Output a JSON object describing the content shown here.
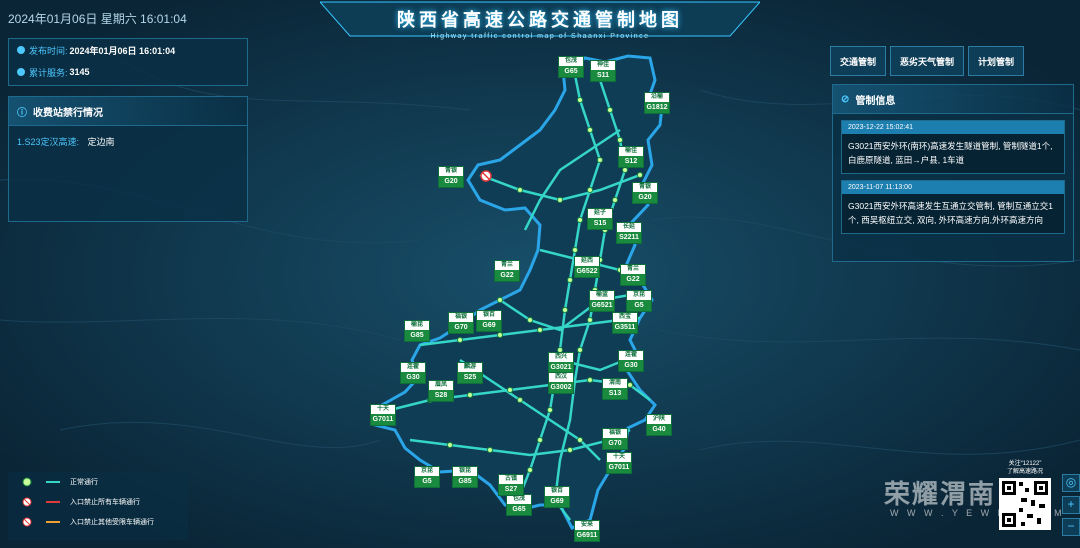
{
  "header": {
    "datetime": "2024年01月06日 星期六  16:01:04",
    "title": "陕西省高速公路交通管制地图",
    "subtitle": "Highway traffic control map of Shaanxi Province"
  },
  "info": {
    "publish_label": "发布时间:",
    "publish_value": "2024年01月06日 16:01:04",
    "service_label": "累计服务:",
    "service_value": "3145"
  },
  "toll": {
    "title": "收费站禁行情况",
    "items": [
      {
        "road": "1.S23定汉高速:",
        "place": "定边南"
      }
    ]
  },
  "tabs": [
    "交通管制",
    "恶劣天气管制",
    "计划管制"
  ],
  "control": {
    "title": "管制信息",
    "messages": [
      {
        "time": "2023-12-22 15:02:41",
        "text": "G3021西安外环(南环)高速发生隧道管制, 管制隧道1个, 白鹿原隧道, 蓝田→户县, 1车道"
      },
      {
        "time": "2023-11-07 11:13:00",
        "text": "G3021西安外环高速发生互通立交管制, 管制互通立交1个, 西吴枢纽立交, 双向, 外环高速方向,外环高速方向"
      }
    ]
  },
  "legend": [
    {
      "label": "正常通行",
      "color": "#35d6c8",
      "icon": "normal-dot-icon"
    },
    {
      "label": "入口禁止所有车辆通行",
      "color": "#e03a3a",
      "icon": "no-entry-icon"
    },
    {
      "label": "入口禁止其他受限车辆通行",
      "color": "#f0a030",
      "icon": "restricted-entry-icon"
    }
  ],
  "qr": {
    "caption1": "关注“12122”",
    "caption2": "了解高速路况"
  },
  "watermark": {
    "text": "荣耀渭南",
    "url": "W W W . Y E W N . C O M"
  },
  "colors": {
    "road": "#35d6c8",
    "province": "#2aa6e8",
    "shield": "#1a8a3e"
  },
  "shields": [
    {
      "name": "包茂",
      "code": "G65"
    },
    {
      "name": "神佳",
      "code": "S11"
    },
    {
      "name": "沿榆",
      "code": "G1812"
    },
    {
      "name": "榆佳",
      "code": "S12"
    },
    {
      "name": "青银",
      "code": "G20"
    },
    {
      "name": "青银",
      "code": "G20"
    },
    {
      "name": "延子",
      "code": "S15"
    },
    {
      "name": "长延",
      "code": "S2211"
    },
    {
      "name": "青兰",
      "code": "G22"
    },
    {
      "name": "延西",
      "code": "G6522"
    },
    {
      "name": "青兰",
      "code": "G22"
    },
    {
      "name": "榆蓝",
      "code": "G6521"
    },
    {
      "name": "京昆",
      "code": "G5"
    },
    {
      "name": "福银",
      "code": "G70"
    },
    {
      "name": "银百",
      "code": "G69"
    },
    {
      "name": "西宝",
      "code": "G3511"
    },
    {
      "name": "榆昆",
      "code": "G85"
    },
    {
      "name": "麟游",
      "code": "S25"
    },
    {
      "name": "西兴",
      "code": "G3021"
    },
    {
      "name": "西汉",
      "code": "G3002"
    },
    {
      "name": "连霍",
      "code": "G30"
    },
    {
      "name": "连霍",
      "code": "G30"
    },
    {
      "name": "眉凤",
      "code": "S28"
    },
    {
      "name": "渭南",
      "code": "S13"
    },
    {
      "name": "十天",
      "code": "G7011"
    },
    {
      "name": "沪陕",
      "code": "G40"
    },
    {
      "name": "福银",
      "code": "G70"
    },
    {
      "name": "十天",
      "code": "G7011"
    },
    {
      "name": "京昆",
      "code": "G5"
    },
    {
      "name": "银昆",
      "code": "G85"
    },
    {
      "name": "包茂",
      "code": "G65"
    },
    {
      "name": "古镇",
      "code": "S27"
    },
    {
      "name": "银百",
      "code": "G69"
    },
    {
      "name": "安来",
      "code": "G6911"
    }
  ]
}
